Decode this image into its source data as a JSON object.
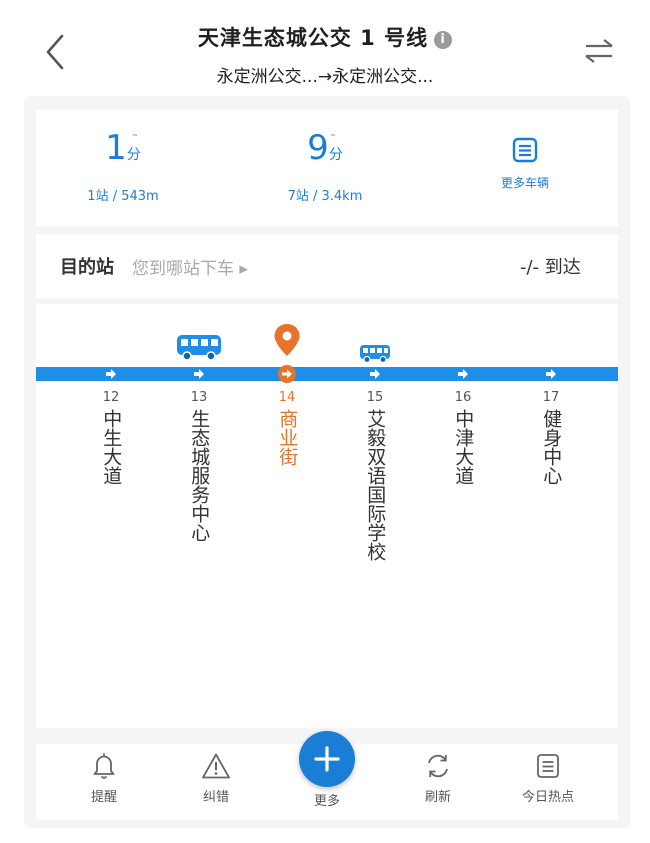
{
  "header": {
    "title": "天津生态城公交 1 号线",
    "info_glyph": "i",
    "subtitle": "永定洲公交...→永定洲公交..."
  },
  "eta": [
    {
      "value": "1",
      "unit": "分",
      "stops_distance": "1站 / 543m"
    },
    {
      "value": "9",
      "unit": "分",
      "stops_distance": "7站 / 3.4km"
    }
  ],
  "more_vehicles": {
    "label": "更多车辆"
  },
  "destination": {
    "label": "目的站",
    "prompt": "您到哪站下车 ▸",
    "arrival": "-/- 到达"
  },
  "stops": [
    {
      "number": "12",
      "name": "中生大道"
    },
    {
      "number": "13",
      "name": "生态城服务中心"
    },
    {
      "number": "14",
      "name": "商业街",
      "current": true
    },
    {
      "number": "15",
      "name": "艾毅双语国际学校"
    },
    {
      "number": "16",
      "name": "中津大道"
    },
    {
      "number": "17",
      "name": "健身中心"
    }
  ],
  "tabs": [
    {
      "label": "提醒",
      "icon": "bell-icon"
    },
    {
      "label": "纠错",
      "icon": "warning-icon"
    },
    {
      "label": "更多",
      "icon": "plus-icon"
    },
    {
      "label": "刷新",
      "icon": "refresh-icon"
    },
    {
      "label": "今日热点",
      "icon": "news-icon"
    }
  ],
  "colors": {
    "accent": "#1b7ed6",
    "route_line": "#1e8ee8",
    "current_stop": "#e8732a"
  }
}
